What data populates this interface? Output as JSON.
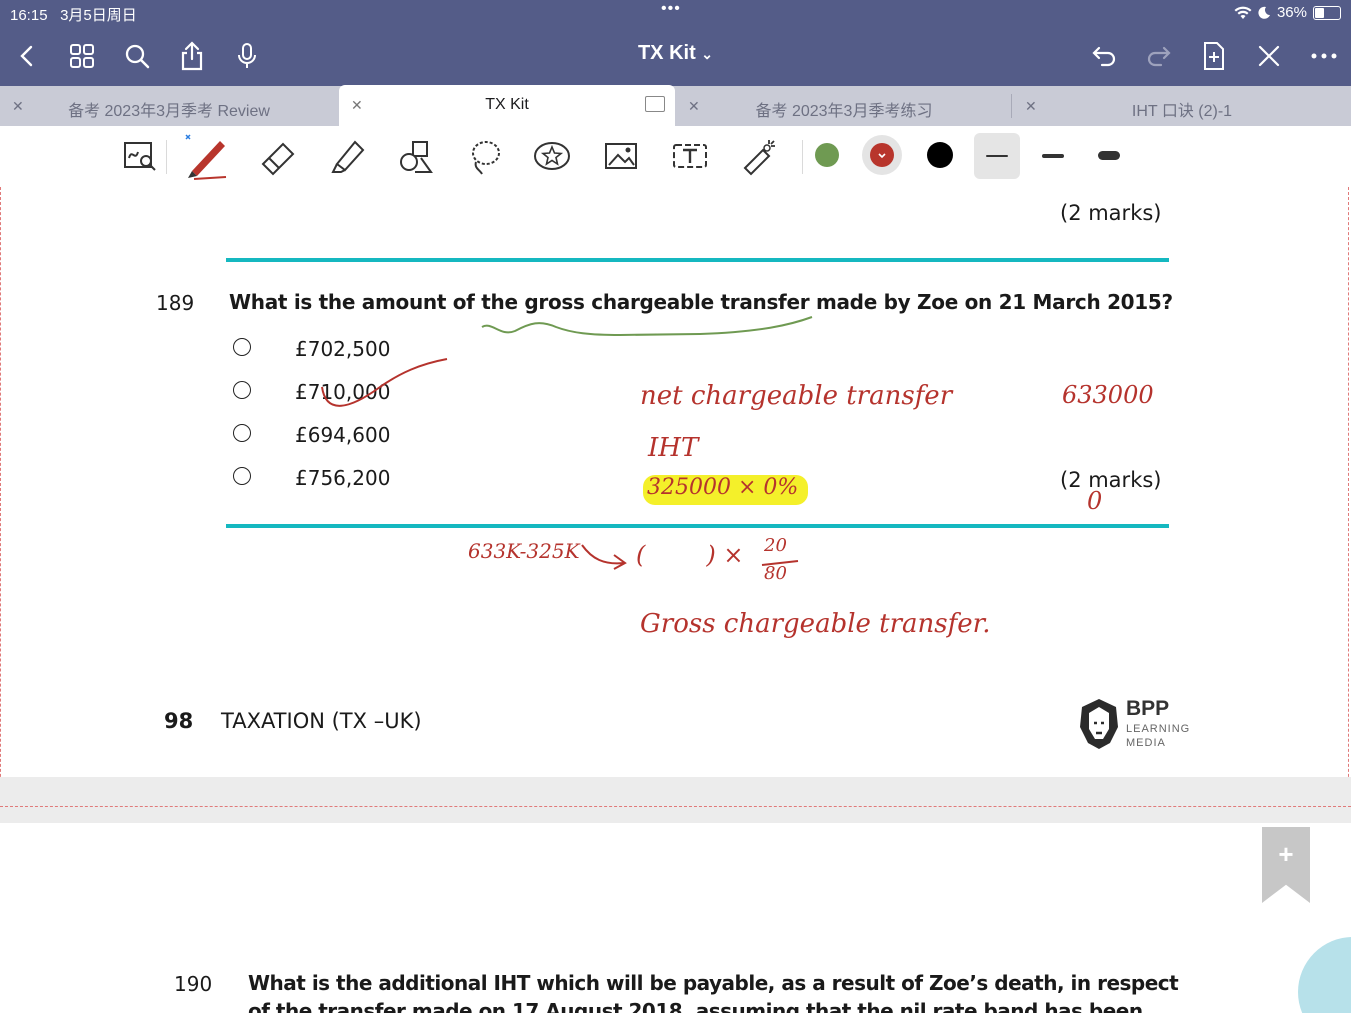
{
  "status": {
    "time": "16:15",
    "date": "3月5日周日",
    "dots": "•••",
    "battery": "36%",
    "battery_level": 0.36
  },
  "nav": {
    "title": "TX Kit",
    "title_chevron": "⌄"
  },
  "tabs": [
    {
      "label": "备考 2023年3月季考 Review",
      "active": false
    },
    {
      "label": "TX Kit",
      "active": true
    },
    {
      "label": "备考 2023年3月季考练习",
      "active": false
    },
    {
      "label": "IHT 口诀 (2)-1",
      "active": false
    }
  ],
  "toolbar": {
    "colors": [
      "#6f9a52",
      "#b8352c",
      "#000000"
    ],
    "selected_color": "#b8352c"
  },
  "page": {
    "prev_marks": "(2 marks)",
    "question_number": "189",
    "question_text": "What is the amount of the gross chargeable transfer made by Zoe on 21 March 2015?",
    "options": [
      "£702,500",
      "£710,000",
      "£694,600",
      "£756,200"
    ],
    "marks": "(2 marks)",
    "footer_page": "98",
    "footer_title": "TAXATION (TX –UK)",
    "logo": {
      "line1": "BPP",
      "line2": "LEARNING",
      "line3": "MEDIA"
    },
    "next_question_number": "190",
    "next_question_text": "What is the additional IHT which will be payable, as a result of Zoe’s death, in respect",
    "next_question_text2": "of the transfer made on 17 August 2018, assuming that the nil rate band has been"
  },
  "handwriting": {
    "net_transfer": "net  chargeable  transfer",
    "net_value": "633000",
    "iht": "IHT",
    "calc": "325000 × 0%",
    "zero": "0",
    "formula_left": "633K-325K",
    "formula_paren": "(        ) ×",
    "frac_num": "20",
    "frac_den": "80",
    "gross": "Gross  chargeable  transfer."
  },
  "bookmark_label": "+"
}
